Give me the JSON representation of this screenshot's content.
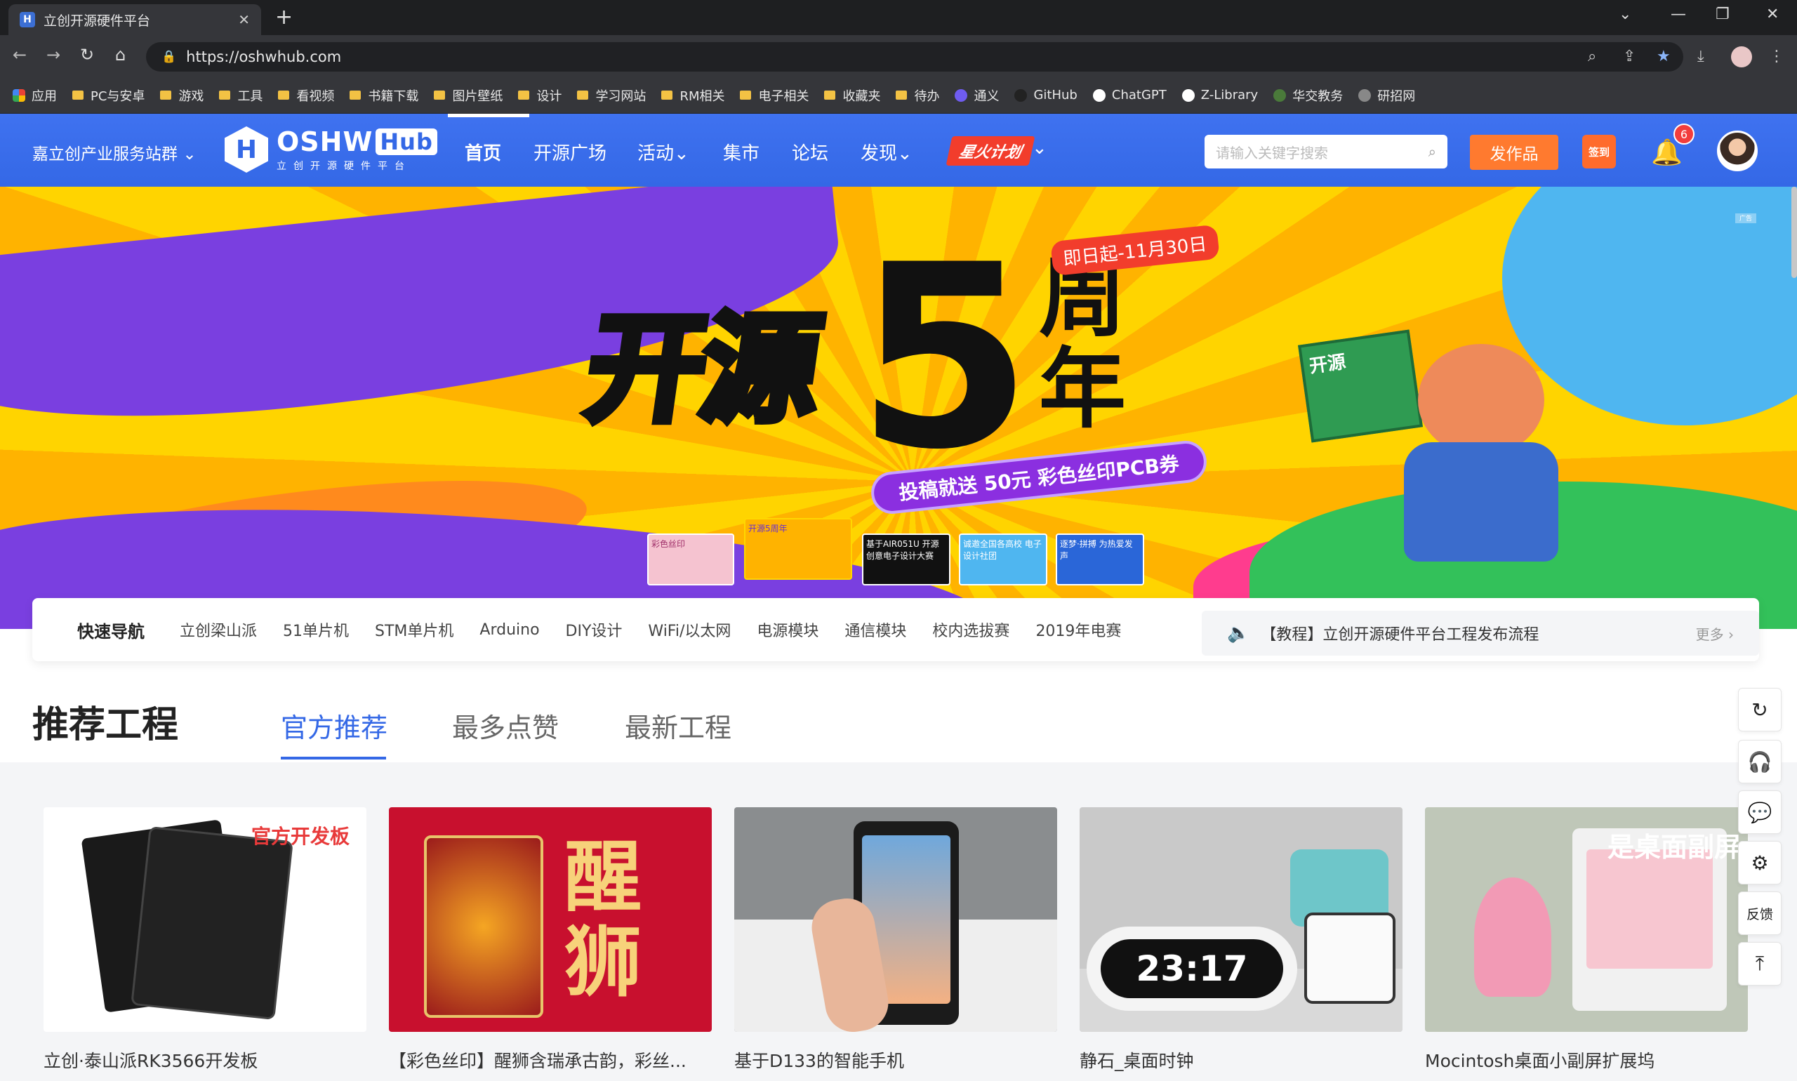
{
  "browser": {
    "tab_title": "立创开源硬件平台",
    "favicon_letter": "H",
    "url": "https://oshwhub.com",
    "bookmarks": [
      {
        "label": "应用",
        "type": "apps"
      },
      {
        "label": "PC与安卓",
        "type": "folder"
      },
      {
        "label": "游戏",
        "type": "folder"
      },
      {
        "label": "工具",
        "type": "folder"
      },
      {
        "label": "看视频",
        "type": "folder"
      },
      {
        "label": "书籍下载",
        "type": "folder"
      },
      {
        "label": "图片壁纸",
        "type": "folder"
      },
      {
        "label": "设计",
        "type": "folder"
      },
      {
        "label": "学习网站",
        "type": "folder"
      },
      {
        "label": "RM相关",
        "type": "folder"
      },
      {
        "label": "电子相关",
        "type": "folder"
      },
      {
        "label": "收藏夹",
        "type": "folder"
      },
      {
        "label": "待办",
        "type": "folder"
      },
      {
        "label": "通义",
        "type": "site",
        "color": "#6f5cf0"
      },
      {
        "label": "GitHub",
        "type": "site",
        "color": "#222222"
      },
      {
        "label": "ChatGPT",
        "type": "site",
        "color": "#ffffff"
      },
      {
        "label": "Z-Library",
        "type": "site",
        "color": "#ffffff"
      },
      {
        "label": "华交教务",
        "type": "site",
        "color": "#4a7a3a"
      },
      {
        "label": "研招网",
        "type": "site",
        "color": "#888888"
      }
    ]
  },
  "header": {
    "station": "嘉立创产业服务站群",
    "logo_main": "OSHW",
    "logo_hub": "Hub",
    "logo_sub": "立创开源硬件平台",
    "menu": [
      {
        "label": "首页",
        "active": true
      },
      {
        "label": "开源广场"
      },
      {
        "label": "活动"
      },
      {
        "label": "集市"
      },
      {
        "label": "论坛"
      },
      {
        "label": "发现"
      }
    ],
    "spark_label": "星火计划",
    "search_placeholder": "请输入关键字搜索",
    "publish_label": "发作品",
    "signin_label": "签到",
    "notification_count": "6",
    "accent": "#3468e6"
  },
  "banner": {
    "title": "开源",
    "number": "5",
    "year": "周年",
    "date": "即日起-11月30日",
    "promo": "投稿就送 50元 彩色丝印PCB券",
    "ad_tag": "广告",
    "board_text": "开源",
    "thumbnails": [
      {
        "label": "彩色丝印",
        "color": "#f5c3d0"
      },
      {
        "label": "开源5周年",
        "color": "#ffb300"
      },
      {
        "label": "基于AIR051U 开源创意电子设计大赛",
        "color": "#111111"
      },
      {
        "label": "诚邀全国各高校 电子设计社团",
        "color": "#4fb6f0"
      },
      {
        "label": "逐梦·拼搏 为热爱发声",
        "color": "#2a66d8"
      }
    ]
  },
  "quick_nav": {
    "label": "快速导航",
    "links": [
      "立创梁山派",
      "51单片机",
      "STM单片机",
      "Arduino",
      "DIY设计",
      "WiFi/以太网",
      "电源模块",
      "通信模块",
      "校内选拔赛",
      "2019年电赛"
    ],
    "notice": "【教程】立创开源硬件平台工程发布流程",
    "more": "更多"
  },
  "recommend": {
    "title": "推荐工程",
    "tabs": [
      {
        "label": "官方推荐",
        "active": true
      },
      {
        "label": "最多点赞"
      },
      {
        "label": "最新工程"
      }
    ],
    "cards": [
      {
        "title": "立创·泰山派RK3566开发板",
        "image": "dev-board-photo",
        "overlay": "官方开发板"
      },
      {
        "title": "【彩色丝印】醒狮含瑞承古韵，彩丝...",
        "image": "lion-pcb-photo",
        "overlay": "醒狮"
      },
      {
        "title": "基于D133的智能手机",
        "image": "smartphone-photo",
        "overlay": ""
      },
      {
        "title": "静石_桌面时钟",
        "image": "desk-clock-photo",
        "overlay": "23:17"
      },
      {
        "title": "Mocintosh桌面小副屏扩展坞",
        "image": "desk-screen-photo",
        "overlay": "是桌面副屏"
      }
    ]
  },
  "side_tools": [
    {
      "name": "refresh",
      "label": "↻"
    },
    {
      "name": "support",
      "label": "🎧"
    },
    {
      "name": "chat",
      "label": "💬"
    },
    {
      "name": "settings",
      "label": "⚙"
    },
    {
      "name": "feedback",
      "label": "反馈"
    },
    {
      "name": "back-to-top",
      "label": "⤒"
    }
  ]
}
